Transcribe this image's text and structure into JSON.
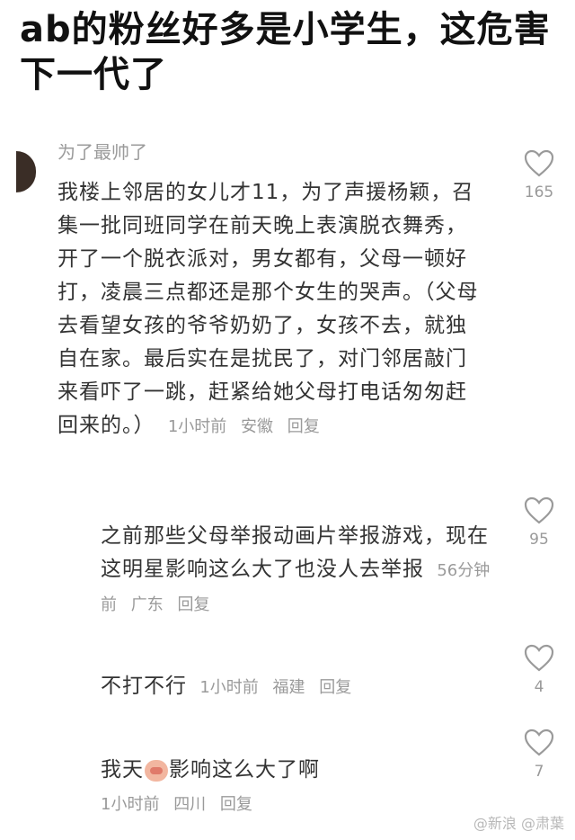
{
  "headline": "ab的粉丝好多是小学生，这危害下一代了",
  "comments": [
    {
      "username": "为了最帅了",
      "text": "我楼上邻居的女儿才11，为了声援杨颖，召集一批同班同学在前天晚上表演脱衣舞秀，开了一个脱衣派对，男女都有，父母一顿好打，凌晨三点都还是那个女生的哭声。（父母去看望女孩的爷爷奶奶了，女孩不去，就独自在家。最后实在是扰民了，对门邻居敲门来看吓了一跳，赶紧给她父母打电话匆匆赶回来的。）",
      "time": "1小时前",
      "location": "安徽",
      "reply": "回复",
      "likes": "165"
    },
    {
      "text": "之前那些父母举报动画片举报游戏，现在这明星影响这么大了也没人去举报",
      "time": "56分钟前",
      "location": "广东",
      "reply": "回复",
      "likes": "95"
    },
    {
      "text": "不打不行",
      "time": "1小时前",
      "location": "福建",
      "reply": "回复",
      "likes": "4"
    },
    {
      "text_before": "我天",
      "emoji": "shy-face-emoji",
      "text_after": "影响这么大了啊",
      "time": "1小时前",
      "location": "四川",
      "reply": "回复",
      "likes": "7"
    }
  ],
  "watermark": "@新浪 @肃葉"
}
